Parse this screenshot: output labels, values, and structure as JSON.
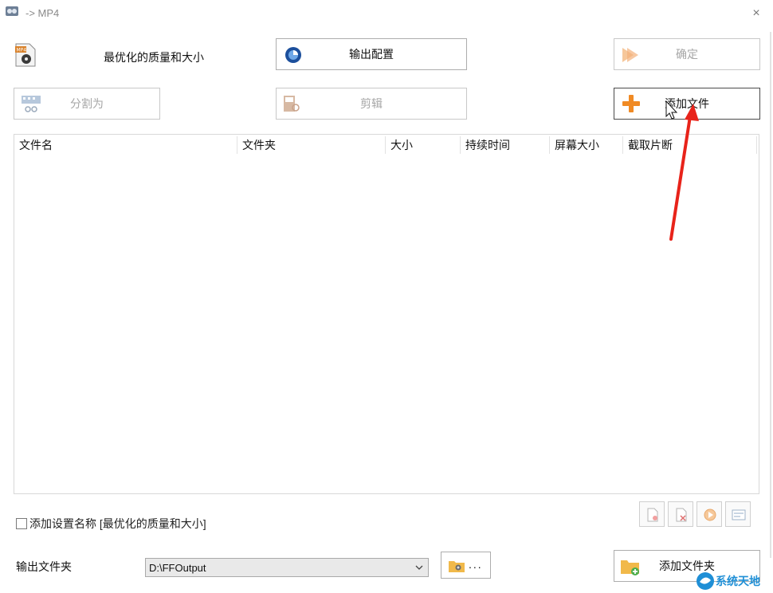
{
  "window": {
    "title": "-> MP4",
    "close_glyph": "×"
  },
  "profile": {
    "label": "最优化的质量和大小",
    "icon": "mp4-file-icon"
  },
  "buttons": {
    "output_config": "输出配置",
    "ok": "确定",
    "split": "分割为",
    "cut": "剪辑",
    "add_file": "添加文件",
    "add_folder": "添加文件夹",
    "browse_dots": "..."
  },
  "file_list": {
    "columns": [
      "文件名",
      "文件夹",
      "大小",
      "持续时间",
      "屏幕大小",
      "截取片断"
    ],
    "rows": []
  },
  "options": {
    "add_setting_name": "添加设置名称 [最优化的质量和大小]",
    "checked": false
  },
  "output": {
    "label": "输出文件夹",
    "folder": "D:\\FFOutput"
  },
  "watermark": {
    "text": "系统天地"
  },
  "colors": {
    "accent_orange": "#f08a24",
    "annotation_red": "#e8231a",
    "watermark_blue": "#1f8fd6"
  }
}
